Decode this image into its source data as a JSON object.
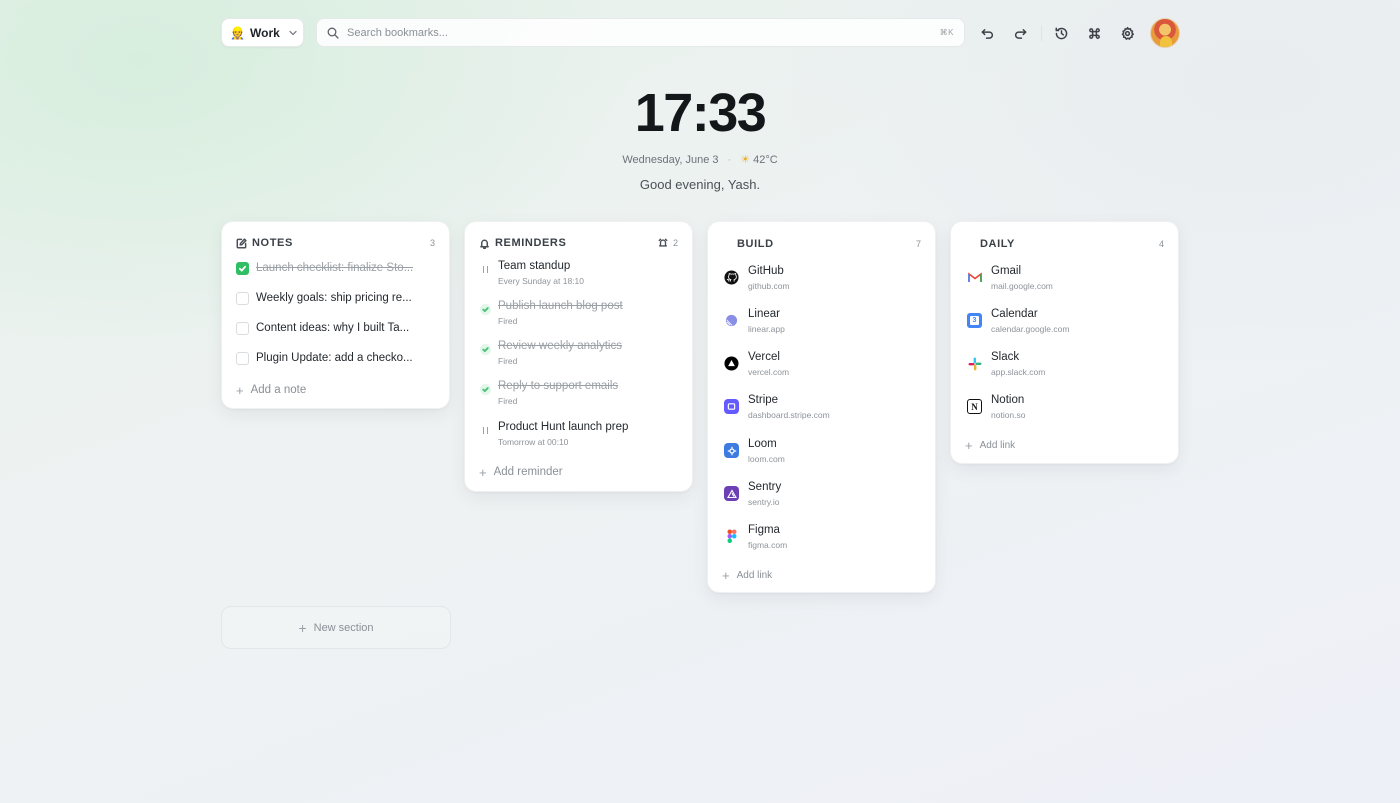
{
  "topbar": {
    "workspace": {
      "emoji": "👷",
      "label": "Work"
    },
    "search": {
      "placeholder": "Search bookmarks...",
      "shortcut": "⌘K"
    },
    "icons": [
      "undo-icon",
      "redo-icon",
      "history-icon",
      "command-icon",
      "gear-icon"
    ]
  },
  "clock": {
    "time": "17:33",
    "date": "Wednesday, June 3",
    "weather_icon": "☀",
    "temperature": "42°C",
    "greeting": "Good evening, Yash."
  },
  "notes": {
    "title": "NOTES",
    "count": "3",
    "items": [
      {
        "text": "Launch checklist: finalize Sto...",
        "done": true
      },
      {
        "text": "Weekly goals: ship pricing re...",
        "done": false
      },
      {
        "text": "Content ideas: why I built Ta...",
        "done": false
      },
      {
        "text": "Plugin Update: add a checko...",
        "done": false
      }
    ],
    "add_label": "Add a note"
  },
  "reminders": {
    "title": "REMINDERS",
    "count": "2",
    "items": [
      {
        "title": "Team standup",
        "sub": "Every Sunday at 18:10",
        "done": false
      },
      {
        "title": "Publish launch blog post",
        "sub": "Fired",
        "done": true
      },
      {
        "title": "Review weekly analytics",
        "sub": "Fired",
        "done": true
      },
      {
        "title": "Reply to support emails",
        "sub": "Fired",
        "done": true
      },
      {
        "title": "Product Hunt launch prep",
        "sub": "Tomorrow at 00:10",
        "done": false
      }
    ],
    "add_label": "Add reminder"
  },
  "build": {
    "title": "BUILD",
    "count": "7",
    "links": [
      {
        "name": "GitHub",
        "url": "github.com",
        "icon": "github-icon",
        "color": "#111111"
      },
      {
        "name": "Linear",
        "url": "linear.app",
        "icon": "linear-icon",
        "color": "#7b83e8"
      },
      {
        "name": "Vercel",
        "url": "vercel.com",
        "icon": "vercel-icon",
        "color": "#000000"
      },
      {
        "name": "Stripe",
        "url": "dashboard.stripe.com",
        "icon": "stripe-icon",
        "color": "#635bff"
      },
      {
        "name": "Loom",
        "url": "loom.com",
        "icon": "loom-icon",
        "color": "#3d7be0"
      },
      {
        "name": "Sentry",
        "url": "sentry.io",
        "icon": "sentry-icon",
        "color": "#6c3fb5"
      },
      {
        "name": "Figma",
        "url": "figma.com",
        "icon": "figma-icon",
        "color": "#f24e1e"
      }
    ],
    "add_label": "Add link"
  },
  "daily": {
    "title": "DAILY",
    "count": "4",
    "links": [
      {
        "name": "Gmail",
        "url": "mail.google.com",
        "icon": "gmail-icon",
        "color": "#ea4335"
      },
      {
        "name": "Calendar",
        "url": "calendar.google.com",
        "icon": "calendar-icon",
        "color": "#4285f4"
      },
      {
        "name": "Slack",
        "url": "app.slack.com",
        "icon": "slack-icon",
        "color": "#e01e5a"
      },
      {
        "name": "Notion",
        "url": "notion.so",
        "icon": "notion-icon",
        "color": "#111111"
      }
    ],
    "add_label": "Add link"
  },
  "new_section_label": "New section",
  "colors": {
    "accent_green": "#2fbe63",
    "card_bg": "#ffffff"
  }
}
